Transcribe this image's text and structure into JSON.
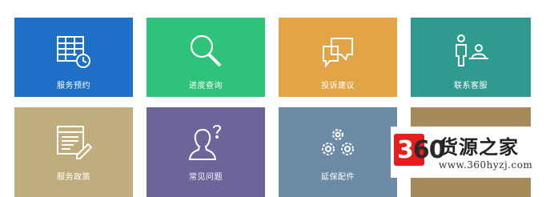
{
  "tiles": [
    {
      "label": "服务预约",
      "icon": "calendar-clock-icon",
      "color": "#1e6fc8"
    },
    {
      "label": "进度查询",
      "icon": "magnifier-icon",
      "color": "#2ec27a"
    },
    {
      "label": "投诉建议",
      "icon": "chat-bubbles-icon",
      "color": "#e2a447"
    },
    {
      "label": "联系客服",
      "icon": "service-desk-icon",
      "color": "#2e9a90"
    },
    {
      "label": "服务政策",
      "icon": "document-pen-icon",
      "color": "#c0ad7d"
    },
    {
      "label": "常见问题",
      "icon": "person-question-icon",
      "color": "#6b6599"
    },
    {
      "label": "延保配件",
      "icon": "gears-icon",
      "color": "#6b8aa5"
    },
    {
      "label": "",
      "icon": "",
      "color": "#a68a5a"
    }
  ],
  "watermark": {
    "logo_text_a": "3",
    "logo_text_b": "6",
    "logo_text_c": "0",
    "site_name": "货源之家",
    "url": "www.360hyzj.com"
  }
}
